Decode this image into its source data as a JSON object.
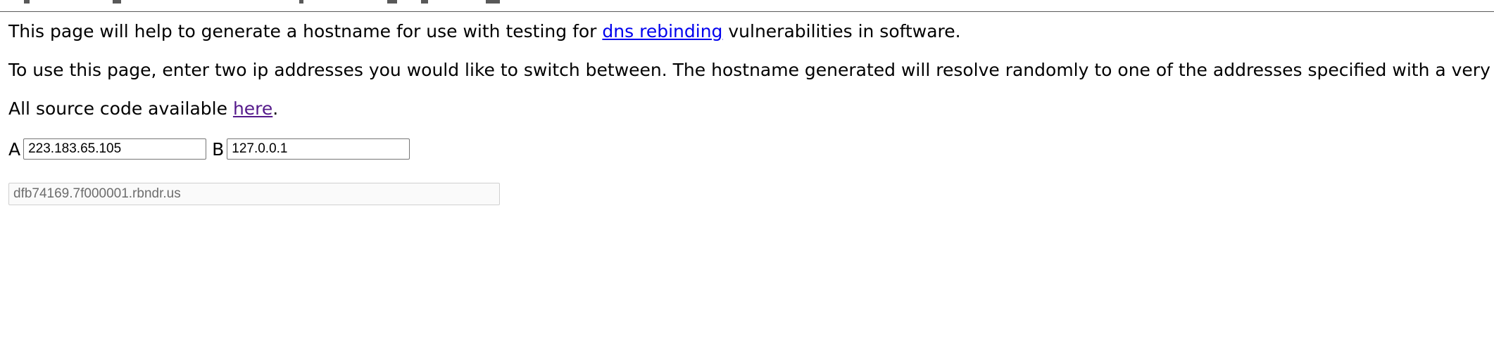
{
  "intro": {
    "line1_before": "This page will help to generate a hostname for use with testing for ",
    "line1_link": "dns rebinding",
    "line1_after": " vulnerabilities in software.",
    "line2": "To use this page, enter two ip addresses you would like to switch between. The hostname generated will resolve randomly to one of the addresses specified with a very low ttl.",
    "line3_before": "All source code available ",
    "line3_link": "here",
    "line3_after": "."
  },
  "form": {
    "label_a": "A",
    "value_a": "223.183.65.105",
    "label_b": "B",
    "value_b": "127.0.0.1"
  },
  "result": {
    "hostname": "dfb74169.7f000001.rbndr.us"
  },
  "colors": {
    "link": "#0000ee",
    "visited_link": "#551a8b",
    "readonly_text": "#6d6d6d"
  }
}
